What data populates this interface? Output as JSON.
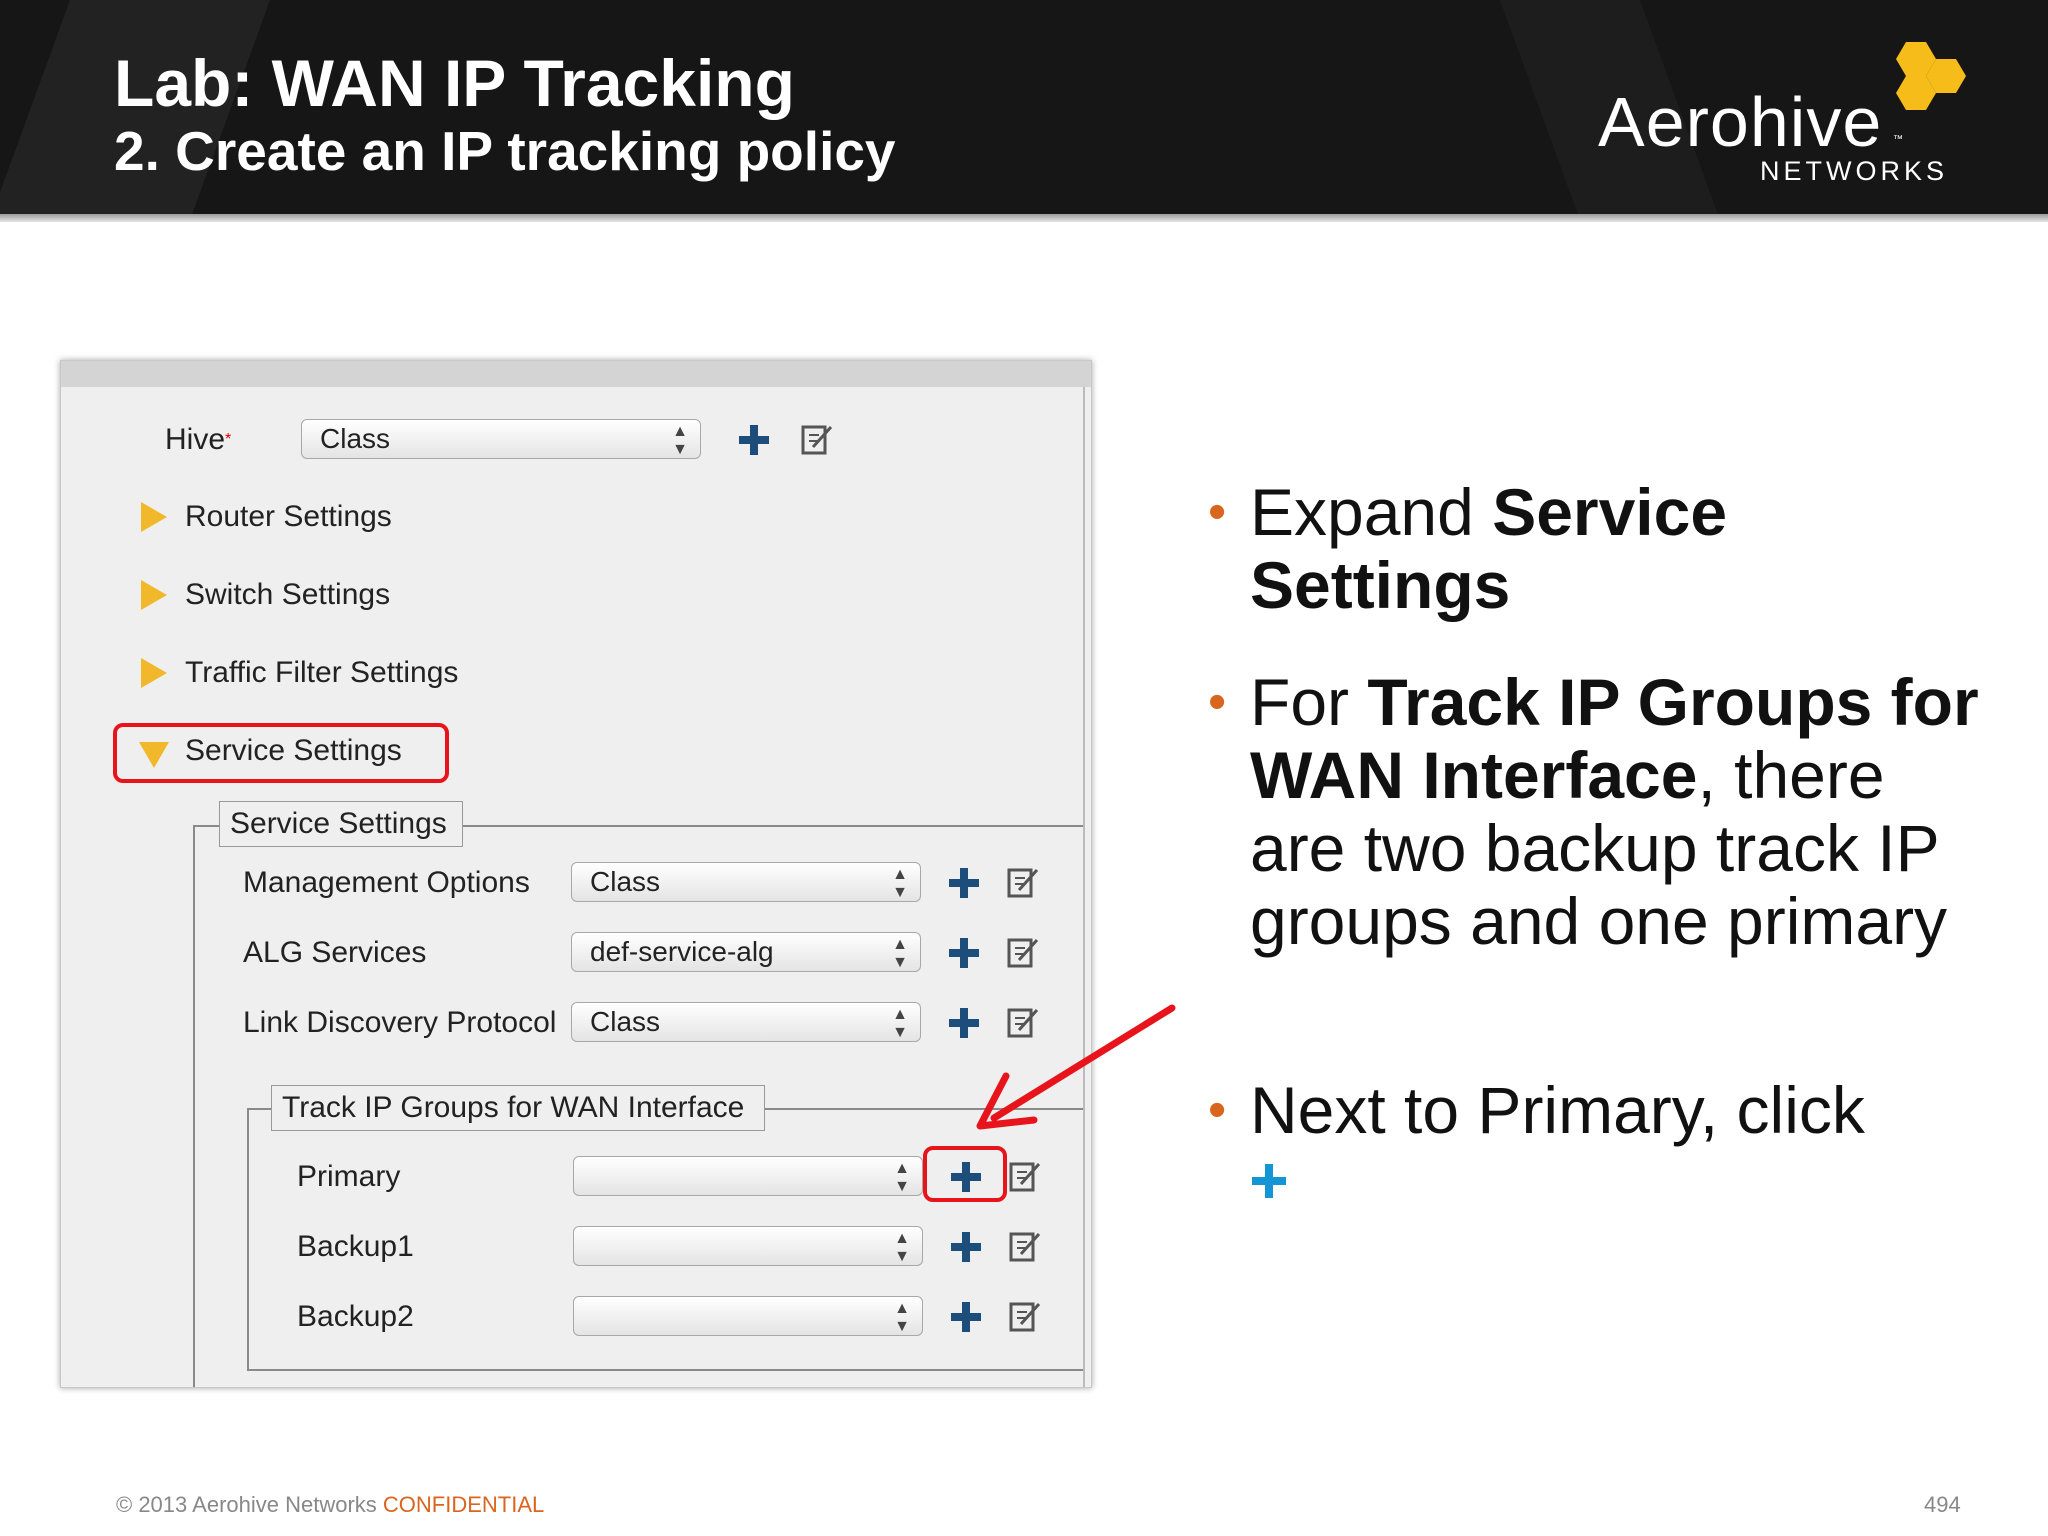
{
  "slide": {
    "title": "Lab: WAN IP Tracking",
    "subtitle": "2. Create an IP tracking policy",
    "logo": {
      "name": "Aerohive",
      "tm": "™",
      "tagline": "NETWORKS",
      "color": "#f6bd1a"
    }
  },
  "ui": {
    "hive": {
      "label": "Hive",
      "required_mark": "*",
      "value": "Class"
    },
    "sections": [
      {
        "label": "Router Settings",
        "state": "collapsed"
      },
      {
        "label": "Switch Settings",
        "state": "collapsed"
      },
      {
        "label": "Traffic Filter Settings",
        "state": "collapsed"
      },
      {
        "label": "Service Settings",
        "state": "expanded"
      }
    ],
    "service_settings": {
      "legend": "Service Settings",
      "rows": [
        {
          "label": "Management Options",
          "value": "Class"
        },
        {
          "label": "ALG Services",
          "value": "def-service-alg"
        },
        {
          "label": "Link Discovery Protocol",
          "value": "Class"
        }
      ]
    },
    "track_ip": {
      "legend": "Track IP Groups for WAN Interface",
      "rows": [
        {
          "label": "Primary",
          "value": ""
        },
        {
          "label": "Backup1",
          "value": ""
        },
        {
          "label": "Backup2",
          "value": ""
        }
      ]
    }
  },
  "bullets": {
    "b1_pre": "Expand ",
    "b1_bold": "Service Settings",
    "b2_pre": "For ",
    "b2_bold": "Track IP Groups for WAN Interface",
    "b2_post": ", there are two backup track IP groups and one primary",
    "b3_text": "Next to Primary, click"
  },
  "footer": {
    "copyright": "© 2013 Aerohive Networks ",
    "confidential": "CONFIDENTIAL",
    "page": "494"
  },
  "colors": {
    "highlight": "#e8141c",
    "accent_orange": "#d9661f",
    "plus_dark": "#1d4d7a",
    "plus_blue": "#1596d4"
  }
}
